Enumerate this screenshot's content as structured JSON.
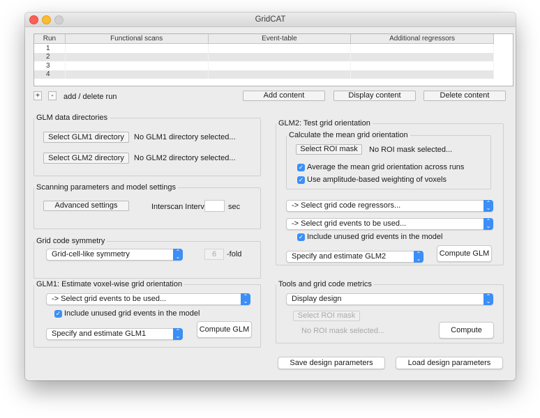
{
  "window": {
    "title": "GridCAT"
  },
  "table": {
    "headers": [
      "Run",
      "Functional scans",
      "Event-table",
      "Additional regressors"
    ],
    "rows": [
      {
        "run": "1",
        "functional_scans": "",
        "event_table": "",
        "additional_regressors": ""
      },
      {
        "run": "2",
        "functional_scans": "",
        "event_table": "",
        "additional_regressors": ""
      },
      {
        "run": "3",
        "functional_scans": "",
        "event_table": "",
        "additional_regressors": ""
      },
      {
        "run": "4",
        "functional_scans": "",
        "event_table": "",
        "additional_regressors": ""
      }
    ]
  },
  "run_controls": {
    "add_label": "+",
    "delete_label": "-",
    "caption": "add / delete run",
    "add_content": "Add content",
    "display_content": "Display content",
    "delete_content": "Delete content"
  },
  "glm_dirs": {
    "legend": "GLM data directories",
    "glm1_button": "Select GLM1 directory",
    "glm1_status": "No GLM1 directory selected...",
    "glm2_button": "Select GLM2 directory",
    "glm2_status": "No GLM2 directory selected..."
  },
  "scanning": {
    "legend": "Scanning parameters and model settings",
    "advanced_button": "Advanced settings",
    "interscan_label": "Interscan Interval:",
    "interscan_value": "",
    "unit": "sec"
  },
  "symmetry": {
    "legend": "Grid code symmetry",
    "selected": "Grid-cell-like symmetry",
    "fold_value": "6",
    "fold_label": "-fold"
  },
  "glm1": {
    "legend": "GLM1: Estimate voxel-wise grid orientation",
    "events_select": "-> Select grid events to be used...",
    "include_unused_label": "Include unused grid events in the model",
    "include_unused_checked": true,
    "mode_select": "Specify and estimate GLM1",
    "compute_button": "Compute GLM"
  },
  "glm2": {
    "legend": "GLM2: Test grid orientation",
    "mean": {
      "legend": "Calculate the mean grid orientation",
      "roi_button": "Select ROI mask",
      "roi_status": "No ROI mask selected...",
      "average_label": "Average the mean grid orientation across runs",
      "average_checked": true,
      "weighting_label": "Use amplitude-based weighting of voxels",
      "weighting_checked": true
    },
    "regressors_select": "-> Select grid code regressors...",
    "events_select": "-> Select grid events to be used...",
    "include_unused_label": "Include unused grid events in the model",
    "include_unused_checked": true,
    "mode_select": "Specify and estimate GLM2",
    "compute_button": "Compute GLM"
  },
  "tools": {
    "legend": "Tools and grid code metrics",
    "selected": "Display design",
    "roi_button": "Select ROI mask",
    "roi_status": "No ROI mask selected...",
    "compute_button": "Compute"
  },
  "footer": {
    "save_button": "Save design parameters",
    "load_button": "Load design parameters"
  },
  "icons": {
    "check": "✓",
    "select_arrows": "⌃⌄"
  }
}
